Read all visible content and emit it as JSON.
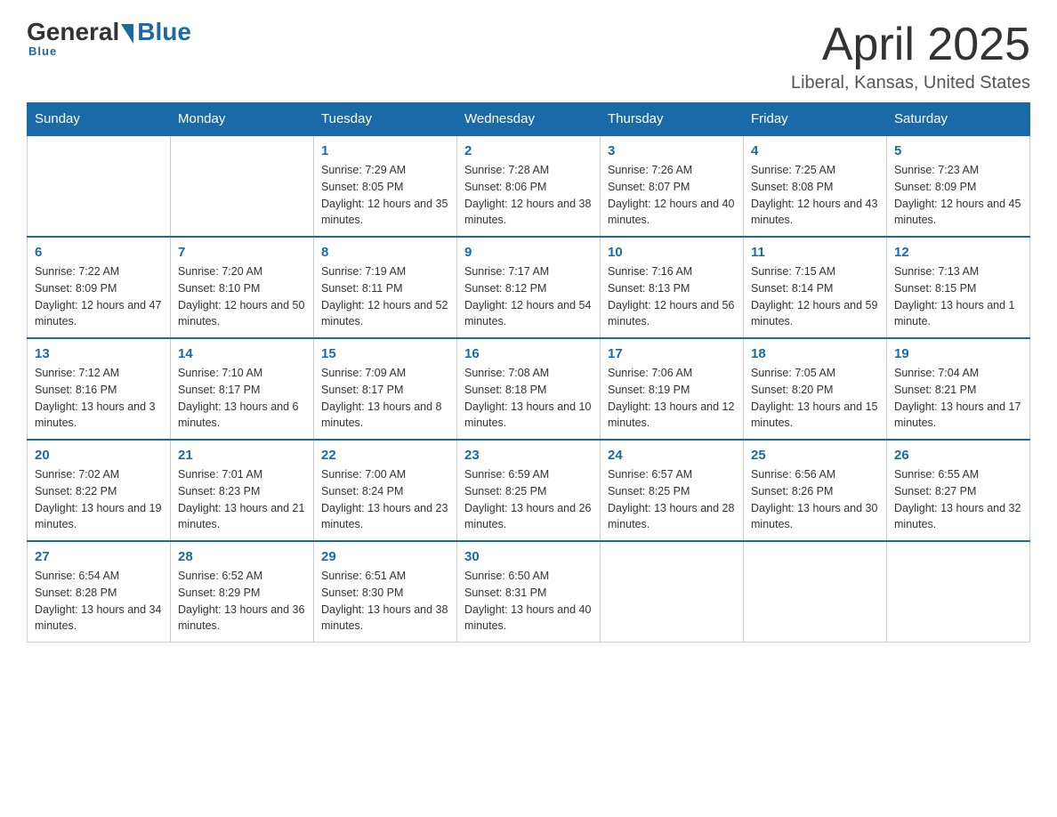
{
  "logo": {
    "text_general": "General",
    "text_blue": "Blue",
    "underline": "Blue"
  },
  "title": {
    "month": "April 2025",
    "location": "Liberal, Kansas, United States"
  },
  "days_of_week": [
    "Sunday",
    "Monday",
    "Tuesday",
    "Wednesday",
    "Thursday",
    "Friday",
    "Saturday"
  ],
  "weeks": [
    [
      {
        "day": "",
        "sunrise": "",
        "sunset": "",
        "daylight": ""
      },
      {
        "day": "",
        "sunrise": "",
        "sunset": "",
        "daylight": ""
      },
      {
        "day": "1",
        "sunrise": "Sunrise: 7:29 AM",
        "sunset": "Sunset: 8:05 PM",
        "daylight": "Daylight: 12 hours and 35 minutes."
      },
      {
        "day": "2",
        "sunrise": "Sunrise: 7:28 AM",
        "sunset": "Sunset: 8:06 PM",
        "daylight": "Daylight: 12 hours and 38 minutes."
      },
      {
        "day": "3",
        "sunrise": "Sunrise: 7:26 AM",
        "sunset": "Sunset: 8:07 PM",
        "daylight": "Daylight: 12 hours and 40 minutes."
      },
      {
        "day": "4",
        "sunrise": "Sunrise: 7:25 AM",
        "sunset": "Sunset: 8:08 PM",
        "daylight": "Daylight: 12 hours and 43 minutes."
      },
      {
        "day": "5",
        "sunrise": "Sunrise: 7:23 AM",
        "sunset": "Sunset: 8:09 PM",
        "daylight": "Daylight: 12 hours and 45 minutes."
      }
    ],
    [
      {
        "day": "6",
        "sunrise": "Sunrise: 7:22 AM",
        "sunset": "Sunset: 8:09 PM",
        "daylight": "Daylight: 12 hours and 47 minutes."
      },
      {
        "day": "7",
        "sunrise": "Sunrise: 7:20 AM",
        "sunset": "Sunset: 8:10 PM",
        "daylight": "Daylight: 12 hours and 50 minutes."
      },
      {
        "day": "8",
        "sunrise": "Sunrise: 7:19 AM",
        "sunset": "Sunset: 8:11 PM",
        "daylight": "Daylight: 12 hours and 52 minutes."
      },
      {
        "day": "9",
        "sunrise": "Sunrise: 7:17 AM",
        "sunset": "Sunset: 8:12 PM",
        "daylight": "Daylight: 12 hours and 54 minutes."
      },
      {
        "day": "10",
        "sunrise": "Sunrise: 7:16 AM",
        "sunset": "Sunset: 8:13 PM",
        "daylight": "Daylight: 12 hours and 56 minutes."
      },
      {
        "day": "11",
        "sunrise": "Sunrise: 7:15 AM",
        "sunset": "Sunset: 8:14 PM",
        "daylight": "Daylight: 12 hours and 59 minutes."
      },
      {
        "day": "12",
        "sunrise": "Sunrise: 7:13 AM",
        "sunset": "Sunset: 8:15 PM",
        "daylight": "Daylight: 13 hours and 1 minute."
      }
    ],
    [
      {
        "day": "13",
        "sunrise": "Sunrise: 7:12 AM",
        "sunset": "Sunset: 8:16 PM",
        "daylight": "Daylight: 13 hours and 3 minutes."
      },
      {
        "day": "14",
        "sunrise": "Sunrise: 7:10 AM",
        "sunset": "Sunset: 8:17 PM",
        "daylight": "Daylight: 13 hours and 6 minutes."
      },
      {
        "day": "15",
        "sunrise": "Sunrise: 7:09 AM",
        "sunset": "Sunset: 8:17 PM",
        "daylight": "Daylight: 13 hours and 8 minutes."
      },
      {
        "day": "16",
        "sunrise": "Sunrise: 7:08 AM",
        "sunset": "Sunset: 8:18 PM",
        "daylight": "Daylight: 13 hours and 10 minutes."
      },
      {
        "day": "17",
        "sunrise": "Sunrise: 7:06 AM",
        "sunset": "Sunset: 8:19 PM",
        "daylight": "Daylight: 13 hours and 12 minutes."
      },
      {
        "day": "18",
        "sunrise": "Sunrise: 7:05 AM",
        "sunset": "Sunset: 8:20 PM",
        "daylight": "Daylight: 13 hours and 15 minutes."
      },
      {
        "day": "19",
        "sunrise": "Sunrise: 7:04 AM",
        "sunset": "Sunset: 8:21 PM",
        "daylight": "Daylight: 13 hours and 17 minutes."
      }
    ],
    [
      {
        "day": "20",
        "sunrise": "Sunrise: 7:02 AM",
        "sunset": "Sunset: 8:22 PM",
        "daylight": "Daylight: 13 hours and 19 minutes."
      },
      {
        "day": "21",
        "sunrise": "Sunrise: 7:01 AM",
        "sunset": "Sunset: 8:23 PM",
        "daylight": "Daylight: 13 hours and 21 minutes."
      },
      {
        "day": "22",
        "sunrise": "Sunrise: 7:00 AM",
        "sunset": "Sunset: 8:24 PM",
        "daylight": "Daylight: 13 hours and 23 minutes."
      },
      {
        "day": "23",
        "sunrise": "Sunrise: 6:59 AM",
        "sunset": "Sunset: 8:25 PM",
        "daylight": "Daylight: 13 hours and 26 minutes."
      },
      {
        "day": "24",
        "sunrise": "Sunrise: 6:57 AM",
        "sunset": "Sunset: 8:25 PM",
        "daylight": "Daylight: 13 hours and 28 minutes."
      },
      {
        "day": "25",
        "sunrise": "Sunrise: 6:56 AM",
        "sunset": "Sunset: 8:26 PM",
        "daylight": "Daylight: 13 hours and 30 minutes."
      },
      {
        "day": "26",
        "sunrise": "Sunrise: 6:55 AM",
        "sunset": "Sunset: 8:27 PM",
        "daylight": "Daylight: 13 hours and 32 minutes."
      }
    ],
    [
      {
        "day": "27",
        "sunrise": "Sunrise: 6:54 AM",
        "sunset": "Sunset: 8:28 PM",
        "daylight": "Daylight: 13 hours and 34 minutes."
      },
      {
        "day": "28",
        "sunrise": "Sunrise: 6:52 AM",
        "sunset": "Sunset: 8:29 PM",
        "daylight": "Daylight: 13 hours and 36 minutes."
      },
      {
        "day": "29",
        "sunrise": "Sunrise: 6:51 AM",
        "sunset": "Sunset: 8:30 PM",
        "daylight": "Daylight: 13 hours and 38 minutes."
      },
      {
        "day": "30",
        "sunrise": "Sunrise: 6:50 AM",
        "sunset": "Sunset: 8:31 PM",
        "daylight": "Daylight: 13 hours and 40 minutes."
      },
      {
        "day": "",
        "sunrise": "",
        "sunset": "",
        "daylight": ""
      },
      {
        "day": "",
        "sunrise": "",
        "sunset": "",
        "daylight": ""
      },
      {
        "day": "",
        "sunrise": "",
        "sunset": "",
        "daylight": ""
      }
    ]
  ]
}
